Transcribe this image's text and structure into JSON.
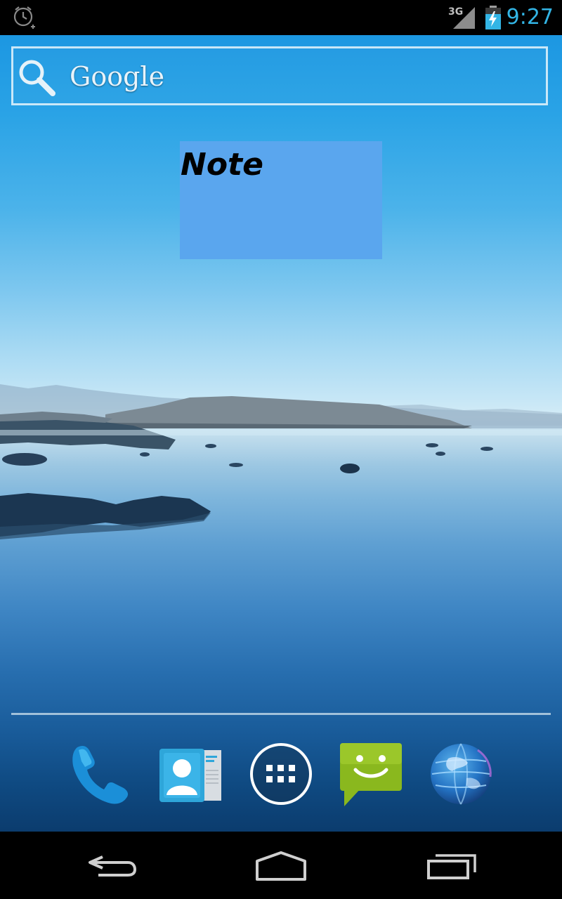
{
  "status_bar": {
    "time": "9:27",
    "network_label": "3G",
    "icons": [
      "alarm-icon",
      "signal-icon",
      "battery-charging-icon"
    ]
  },
  "search_widget": {
    "label": "Google",
    "icon": "search-icon"
  },
  "note_widget": {
    "title": "Note"
  },
  "dock": {
    "apps": [
      {
        "name": "phone-icon"
      },
      {
        "name": "contacts-icon"
      },
      {
        "name": "app-drawer-icon"
      },
      {
        "name": "messaging-icon"
      },
      {
        "name": "browser-icon"
      }
    ]
  },
  "nav_bar": {
    "buttons": [
      "back-icon",
      "home-icon",
      "recent-apps-icon"
    ]
  },
  "colors": {
    "status_accent": "#33b5e5",
    "note_background": "#5aa6ee",
    "messaging_green": "#8ab81e"
  }
}
